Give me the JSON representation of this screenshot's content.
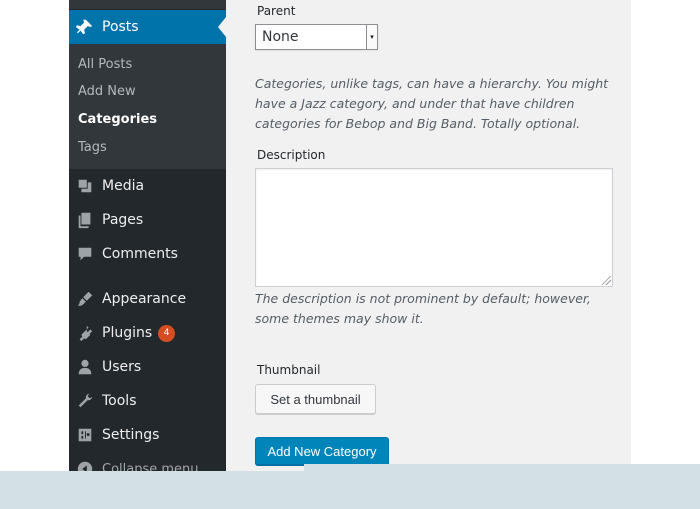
{
  "sidebar": {
    "posts_label": "Posts",
    "submenu": [
      "All Posts",
      "Add New",
      "Categories",
      "Tags"
    ],
    "items": [
      {
        "label": "Media",
        "icon": "media-icon"
      },
      {
        "label": "Pages",
        "icon": "pages-icon"
      },
      {
        "label": "Comments",
        "icon": "comments-icon"
      },
      {
        "label": "Appearance",
        "icon": "appearance-icon"
      },
      {
        "label": "Plugins",
        "icon": "plugins-icon",
        "badge": "4"
      },
      {
        "label": "Users",
        "icon": "users-icon"
      },
      {
        "label": "Tools",
        "icon": "tools-icon"
      },
      {
        "label": "Settings",
        "icon": "settings-icon"
      }
    ],
    "collapse_label": "Collapse menu"
  },
  "form": {
    "parent_label": "Parent",
    "parent_value": "None",
    "parent_help": "Categories, unlike tags, can have a hierarchy. You might have a Jazz category, and under that have children categories for Bebop and Big Band. Totally optional.",
    "description_label": "Description",
    "description_value": "",
    "description_help": "The description is not prominent by default; however, some themes may show it.",
    "thumbnail_label": "Thumbnail",
    "thumbnail_button": "Set a thumbnail",
    "submit_button": "Add New Category"
  },
  "colors": {
    "sidebar_bg": "#23282d",
    "active_bg": "#0073aa",
    "primary_button": "#0085ba",
    "badge": "#d54e21"
  }
}
